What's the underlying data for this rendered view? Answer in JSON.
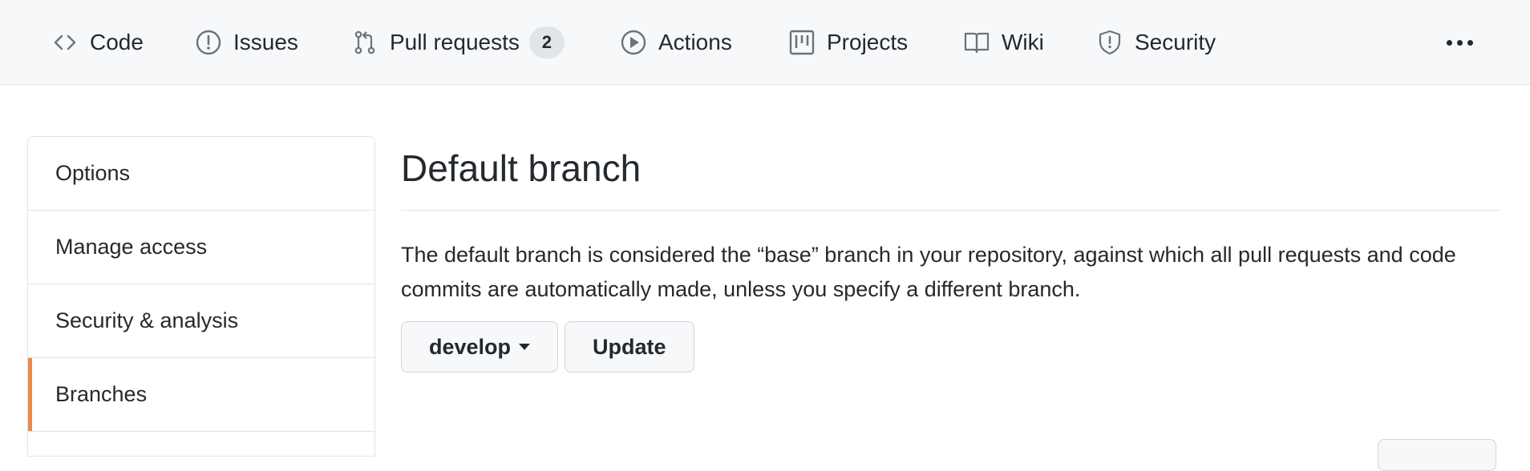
{
  "repo_nav": {
    "tabs": [
      {
        "label": "Code",
        "icon": "code-icon"
      },
      {
        "label": "Issues",
        "icon": "issue-opened-icon"
      },
      {
        "label": "Pull requests",
        "icon": "git-pull-request-icon",
        "count": "2"
      },
      {
        "label": "Actions",
        "icon": "play-icon"
      },
      {
        "label": "Projects",
        "icon": "project-icon"
      },
      {
        "label": "Wiki",
        "icon": "book-icon"
      },
      {
        "label": "Security",
        "icon": "shield-icon"
      }
    ],
    "more_icon": "kebab-horizontal-icon"
  },
  "settings_menu": {
    "items": [
      {
        "label": "Options"
      },
      {
        "label": "Manage access"
      },
      {
        "label": "Security & analysis"
      },
      {
        "label": "Branches",
        "selected": true
      }
    ]
  },
  "default_branch": {
    "title": "Default branch",
    "description": "The default branch is considered the “base” branch in your repository, against which all pull requests and code commits are automatically made, unless you specify a different branch.",
    "branch_select_label": "develop",
    "update_label": "Update"
  },
  "colors": {
    "nav_background": "#f6f8fa",
    "selected_indicator": "#e36209",
    "border": "#e1e4e8",
    "text": "#24292e"
  }
}
